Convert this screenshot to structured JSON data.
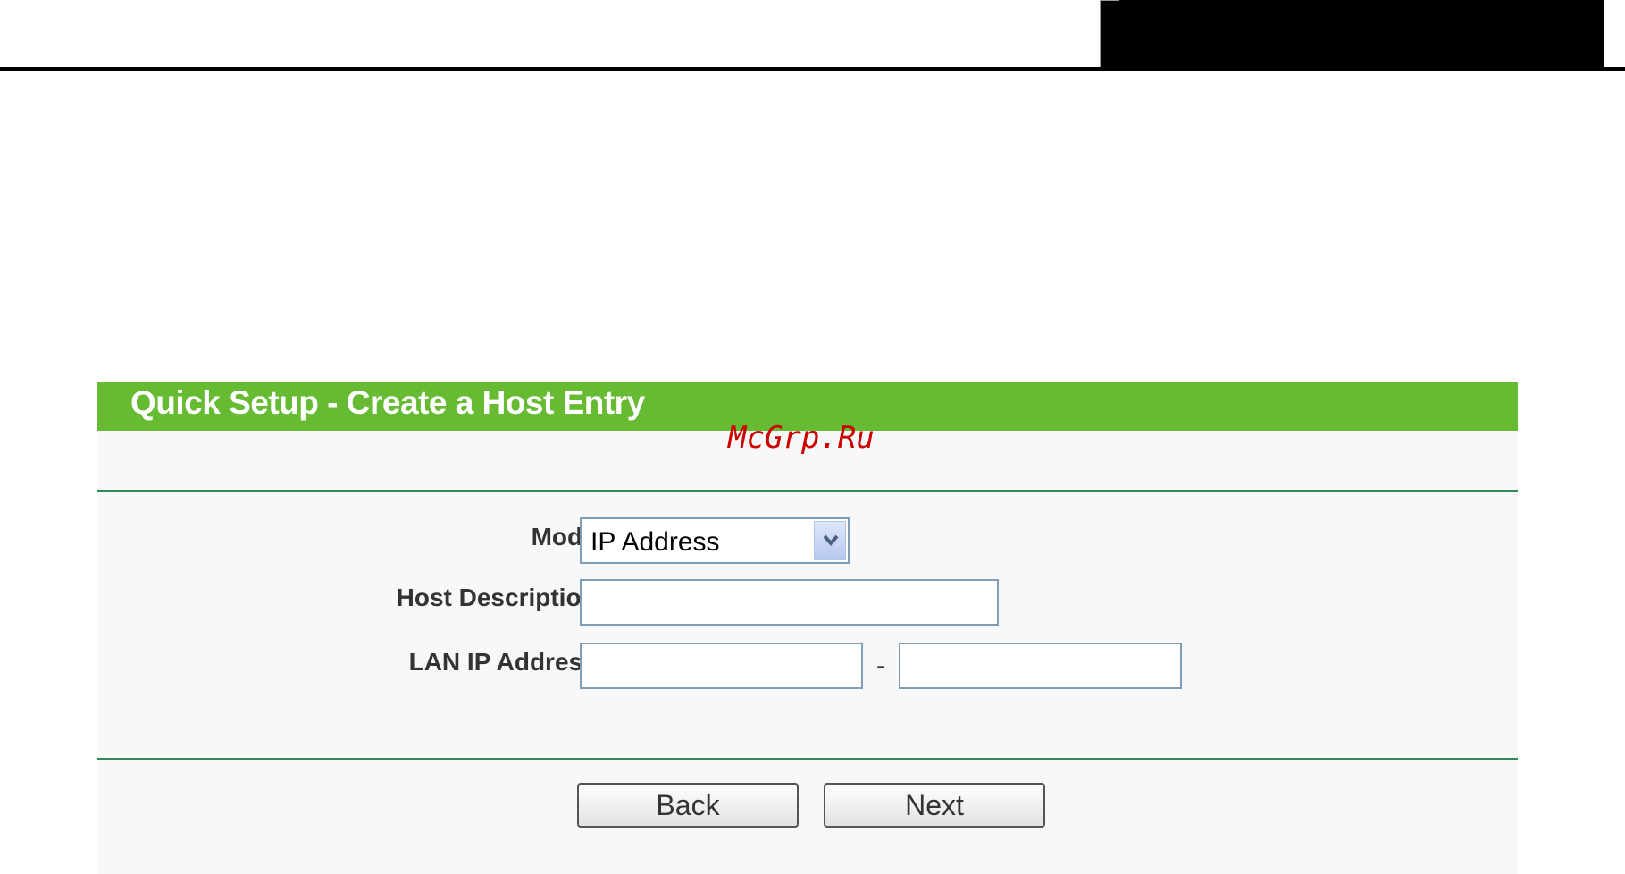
{
  "page": {
    "title": "Quick Setup - Create a Host Entry",
    "watermark": "McGrp.Ru"
  },
  "form": {
    "mode_label": "Mode:",
    "mode_value": "IP Address",
    "host_description_label": "Host Description:",
    "host_description_value": "",
    "lan_ip_label": "LAN IP Address:",
    "lan_ip_start_value": "",
    "lan_ip_separator": "-",
    "lan_ip_end_value": ""
  },
  "buttons": {
    "back_label": "Back",
    "next_label": "Next"
  },
  "colors": {
    "title_bar": "#66bb33",
    "divider": "#2e8b57",
    "watermark": "#cc0000"
  },
  "icons": {
    "mode_dropdown": "chevron-down-icon"
  }
}
